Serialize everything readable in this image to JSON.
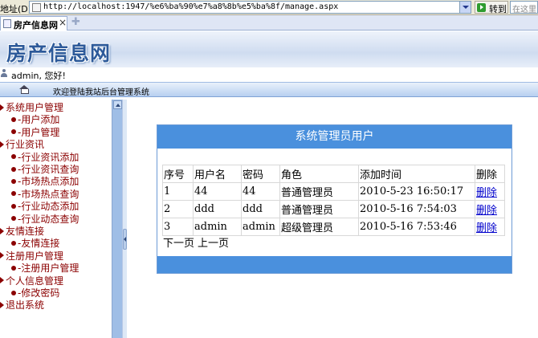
{
  "browser": {
    "address_label": "地址(D)",
    "url": "http://localhost:1947/%e6%ba%90%e7%a8%8b%e5%ba%8f/manage.aspx",
    "go_label": "转到",
    "search_placeholder": "在这里",
    "tab_title": "房产信息网"
  },
  "site": {
    "title": "房产信息网",
    "user_greeting": "admin, 您好!",
    "welcome": "欢迎登陆我站后台管理系统"
  },
  "menu": [
    {
      "label": "系统用户管理",
      "level": 0
    },
    {
      "label": "-用户添加",
      "level": 1
    },
    {
      "label": "-用户管理",
      "level": 1
    },
    {
      "label": "行业资讯",
      "level": 0
    },
    {
      "label": "-行业资讯添加",
      "level": 1
    },
    {
      "label": "-行业资讯查询",
      "level": 1
    },
    {
      "label": "-市场热点添加",
      "level": 1
    },
    {
      "label": "-市场热点查询",
      "level": 1
    },
    {
      "label": "-行业动态添加",
      "level": 1
    },
    {
      "label": "-行业动态查询",
      "level": 1
    },
    {
      "label": "友情连接",
      "level": 0
    },
    {
      "label": "-友情连接",
      "level": 1
    },
    {
      "label": "注册用户管理",
      "level": 0
    },
    {
      "label": "-注册用户管理",
      "level": 1
    },
    {
      "label": "个人信息管理",
      "level": 0
    },
    {
      "label": "-修改密码",
      "level": 1
    },
    {
      "label": "退出系统",
      "level": 0
    }
  ],
  "panel": {
    "title": "系统管理员用户",
    "headers": [
      "序号",
      "用户名",
      "密码",
      "角色",
      "添加时间",
      "删除"
    ],
    "rows": [
      [
        "1",
        "44",
        "44",
        "普通管理员",
        "2010-5-23 16:50:17",
        "删除"
      ],
      [
        "2",
        "ddd",
        "ddd",
        "普通管理员",
        "2010-5-16 7:54:03",
        "删除"
      ],
      [
        "3",
        "admin",
        "admin",
        "超级管理员",
        "2010-5-16 7:53:46",
        "删除"
      ]
    ],
    "next_page": "下一页",
    "prev_page": "上一页"
  }
}
